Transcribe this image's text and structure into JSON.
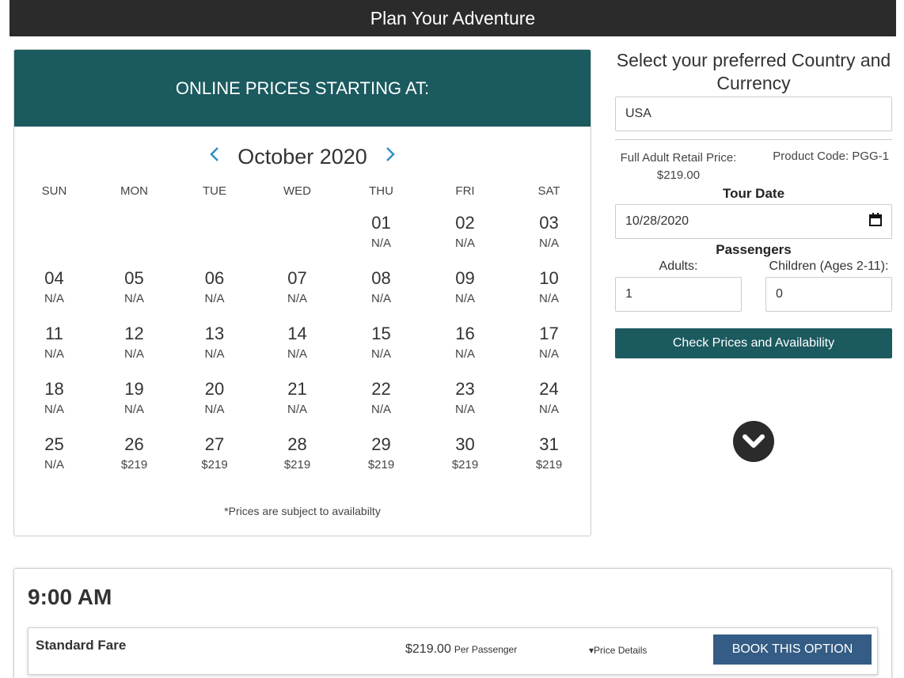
{
  "header": {
    "title": "Plan Your Adventure"
  },
  "calendar": {
    "banner": "ONLINE PRICES STARTING AT:",
    "month": "October 2020",
    "prev_icon": "chevron-left-icon",
    "next_icon": "chevron-right-icon",
    "weekdays": [
      "SUN",
      "MON",
      "TUE",
      "WED",
      "THU",
      "FRI",
      "SAT"
    ],
    "days": [
      {
        "num": "",
        "price": ""
      },
      {
        "num": "",
        "price": ""
      },
      {
        "num": "",
        "price": ""
      },
      {
        "num": "",
        "price": ""
      },
      {
        "num": "01",
        "price": "N/A"
      },
      {
        "num": "02",
        "price": "N/A"
      },
      {
        "num": "03",
        "price": "N/A"
      },
      {
        "num": "04",
        "price": "N/A"
      },
      {
        "num": "05",
        "price": "N/A"
      },
      {
        "num": "06",
        "price": "N/A"
      },
      {
        "num": "07",
        "price": "N/A"
      },
      {
        "num": "08",
        "price": "N/A"
      },
      {
        "num": "09",
        "price": "N/A"
      },
      {
        "num": "10",
        "price": "N/A"
      },
      {
        "num": "11",
        "price": "N/A"
      },
      {
        "num": "12",
        "price": "N/A"
      },
      {
        "num": "13",
        "price": "N/A"
      },
      {
        "num": "14",
        "price": "N/A"
      },
      {
        "num": "15",
        "price": "N/A"
      },
      {
        "num": "16",
        "price": "N/A"
      },
      {
        "num": "17",
        "price": "N/A"
      },
      {
        "num": "18",
        "price": "N/A"
      },
      {
        "num": "19",
        "price": "N/A"
      },
      {
        "num": "20",
        "price": "N/A"
      },
      {
        "num": "21",
        "price": "N/A"
      },
      {
        "num": "22",
        "price": "N/A"
      },
      {
        "num": "23",
        "price": "N/A"
      },
      {
        "num": "24",
        "price": "N/A"
      },
      {
        "num": "25",
        "price": "N/A"
      },
      {
        "num": "26",
        "price": "$219"
      },
      {
        "num": "27",
        "price": "$219"
      },
      {
        "num": "28",
        "price": "$219"
      },
      {
        "num": "29",
        "price": "$219"
      },
      {
        "num": "30",
        "price": "$219"
      },
      {
        "num": "31",
        "price": "$219"
      }
    ],
    "disclaimer": "*Prices are subject to availabilty"
  },
  "booking": {
    "title": "Select your preferred Country and Currency",
    "country": "USA",
    "retail_label": "Full Adult Retail Price:",
    "retail_price": "$219.00",
    "product_code": "Product Code: PGG-1",
    "tour_date_label": "Tour Date",
    "tour_date": "10/28/2020",
    "calendar_icon": "calendar-icon",
    "passengers_label": "Passengers",
    "adults_label": "Adults:",
    "adults_value": "1",
    "children_label": "Children (Ages 2-11):",
    "children_value": "0",
    "check_button": "Check Prices and Availability",
    "scroll_icon": "chevron-down-circle-icon"
  },
  "times": {
    "time": "9:00 AM",
    "fare_name": "Standard Fare",
    "fare_price": "$219.00",
    "fare_per": "Per Passenger",
    "details_label": "Price Details",
    "book_button": "BOOK THIS OPTION"
  }
}
